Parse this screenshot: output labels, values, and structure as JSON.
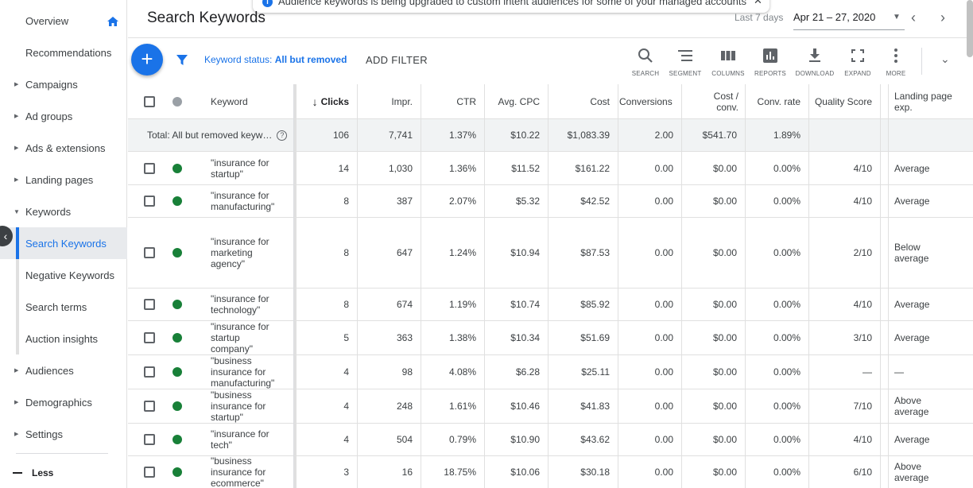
{
  "banner": {
    "text": "Audience keywords is being upgraded to custom intent audiences for some of your managed accounts",
    "close_icon": "close-icon"
  },
  "header": {
    "title": "Search Keywords",
    "date_label": "Last 7 days",
    "date_range": "Apr 21 – 27, 2020"
  },
  "sidebar": {
    "items": [
      {
        "label": "Overview",
        "caret": ""
      },
      {
        "label": "Recommendations",
        "caret": ""
      },
      {
        "label": "Campaigns",
        "caret": "▶"
      },
      {
        "label": "Ad groups",
        "caret": "▶"
      },
      {
        "label": "Ads & extensions",
        "caret": "▶"
      },
      {
        "label": "Landing pages",
        "caret": "▶"
      },
      {
        "label": "Keywords",
        "caret": "▼"
      },
      {
        "label": "Search Keywords",
        "caret": ""
      },
      {
        "label": "Negative Keywords",
        "caret": ""
      },
      {
        "label": "Search terms",
        "caret": ""
      },
      {
        "label": "Auction insights",
        "caret": ""
      },
      {
        "label": "Audiences",
        "caret": "▶"
      },
      {
        "label": "Demographics",
        "caret": "▶"
      },
      {
        "label": "Settings",
        "caret": "▶"
      }
    ],
    "less_label": "Less"
  },
  "toolbar": {
    "filter_label": "Keyword status: ",
    "filter_value": "All but removed",
    "add_filter": "ADD FILTER",
    "tools": [
      "SEARCH",
      "SEGMENT",
      "COLUMNS",
      "REPORTS",
      "DOWNLOAD",
      "EXPAND",
      "MORE"
    ]
  },
  "table": {
    "headers": {
      "keyword": "Keyword",
      "clicks": "Clicks",
      "impr": "Impr.",
      "ctr": "CTR",
      "avg_cpc": "Avg. CPC",
      "cost": "Cost",
      "conversions": "Conversions",
      "cost_conv_1": "Cost /",
      "cost_conv_2": "conv.",
      "conv_rate": "Conv. rate",
      "quality_score": "Quality Score",
      "landing_1": "Landing page",
      "landing_2": "exp."
    },
    "total": {
      "label": "Total: All but removed keyw…",
      "clicks": "106",
      "impr": "7,741",
      "ctr": "1.37%",
      "avg_cpc": "$10.22",
      "cost": "$1,083.39",
      "conversions": "2.00",
      "cost_conv": "$541.70",
      "conv_rate": "1.89%"
    },
    "rows": [
      {
        "keyword": [
          "\"insurance for",
          "startup\""
        ],
        "clicks": "14",
        "impr": "1,030",
        "ctr": "1.36%",
        "avg_cpc": "$11.52",
        "cost": "$161.22",
        "conversions": "0.00",
        "cost_conv": "$0.00",
        "conv_rate": "0.00%",
        "qs": "4/10",
        "landing": [
          "Average"
        ]
      },
      {
        "keyword": [
          "\"insurance for",
          "manufacturing\""
        ],
        "clicks": "8",
        "impr": "387",
        "ctr": "2.07%",
        "avg_cpc": "$5.32",
        "cost": "$42.52",
        "conversions": "0.00",
        "cost_conv": "$0.00",
        "conv_rate": "0.00%",
        "qs": "4/10",
        "landing": [
          "Average"
        ]
      },
      {
        "keyword": [
          "\"insurance for",
          "marketing",
          "agency\""
        ],
        "clicks": "8",
        "impr": "647",
        "ctr": "1.24%",
        "avg_cpc": "$10.94",
        "cost": "$87.53",
        "conversions": "0.00",
        "cost_conv": "$0.00",
        "conv_rate": "0.00%",
        "qs": "2/10",
        "landing": [
          "Below",
          "average"
        ]
      },
      {
        "keyword": [
          "\"insurance for",
          "technology\""
        ],
        "clicks": "8",
        "impr": "674",
        "ctr": "1.19%",
        "avg_cpc": "$10.74",
        "cost": "$85.92",
        "conversions": "0.00",
        "cost_conv": "$0.00",
        "conv_rate": "0.00%",
        "qs": "4/10",
        "landing": [
          "Average"
        ]
      },
      {
        "keyword": [
          "\"insurance for",
          "startup",
          "company\""
        ],
        "clicks": "5",
        "impr": "363",
        "ctr": "1.38%",
        "avg_cpc": "$10.34",
        "cost": "$51.69",
        "conversions": "0.00",
        "cost_conv": "$0.00",
        "conv_rate": "0.00%",
        "qs": "3/10",
        "landing": [
          "Average"
        ]
      },
      {
        "keyword": [
          "\"business",
          "insurance for",
          "manufacturing\""
        ],
        "clicks": "4",
        "impr": "98",
        "ctr": "4.08%",
        "avg_cpc": "$6.28",
        "cost": "$25.11",
        "conversions": "0.00",
        "cost_conv": "$0.00",
        "conv_rate": "0.00%",
        "qs": "—",
        "landing": [
          "—"
        ]
      },
      {
        "keyword": [
          "\"business",
          "insurance for",
          "startup\""
        ],
        "clicks": "4",
        "impr": "248",
        "ctr": "1.61%",
        "avg_cpc": "$10.46",
        "cost": "$41.83",
        "conversions": "0.00",
        "cost_conv": "$0.00",
        "conv_rate": "0.00%",
        "qs": "7/10",
        "landing": [
          "Above",
          "average"
        ]
      },
      {
        "keyword": [
          "\"insurance for",
          "tech\""
        ],
        "clicks": "4",
        "impr": "504",
        "ctr": "0.79%",
        "avg_cpc": "$10.90",
        "cost": "$43.62",
        "conversions": "0.00",
        "cost_conv": "$0.00",
        "conv_rate": "0.00%",
        "qs": "4/10",
        "landing": [
          "Average"
        ]
      },
      {
        "keyword": [
          "\"business",
          "insurance for",
          "ecommerce\""
        ],
        "clicks": "3",
        "impr": "16",
        "ctr": "18.75%",
        "avg_cpc": "$10.06",
        "cost": "$30.18",
        "conversions": "0.00",
        "cost_conv": "$0.00",
        "conv_rate": "0.00%",
        "qs": "6/10",
        "landing": [
          "Above",
          "average"
        ]
      }
    ]
  },
  "colors": {
    "accent": "#1a73e8",
    "enabled_dot": "#188038",
    "header_dot": "#9aa0a6"
  }
}
